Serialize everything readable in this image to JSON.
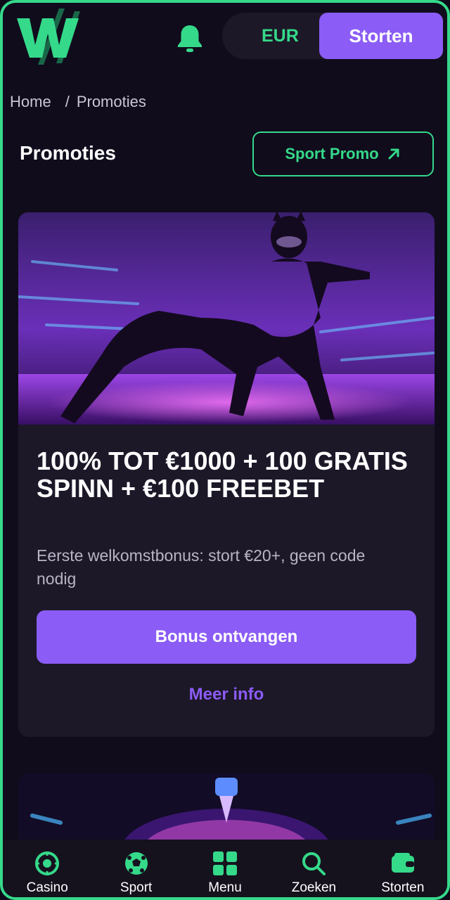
{
  "header": {
    "currency": "EUR",
    "deposit_label": "Storten"
  },
  "breadcrumb": {
    "home": "Home",
    "separator": "/",
    "current": "Promoties"
  },
  "page": {
    "title": "Promoties",
    "sport_promo_label": "Sport Promo"
  },
  "promo": {
    "title": "100% TOT €1000 + 100 GRATIS SPINN + €100 FREEBET",
    "description": "Eerste welkomstbonus: stort €20+, geen code nodig",
    "cta_label": "Bonus ontvangen",
    "more_label": "Meer info"
  },
  "nav": {
    "items": [
      {
        "label": "Casino",
        "icon": "casino-chip-icon"
      },
      {
        "label": "Sport",
        "icon": "soccer-ball-icon"
      },
      {
        "label": "Menu",
        "icon": "grid-menu-icon"
      },
      {
        "label": "Zoeken",
        "icon": "search-icon"
      },
      {
        "label": "Storten",
        "icon": "wallet-icon"
      }
    ]
  },
  "colors": {
    "accent_green": "#35d98a",
    "accent_purple": "#8b5cf6",
    "background": "#100c1c",
    "card": "#1c1828"
  }
}
